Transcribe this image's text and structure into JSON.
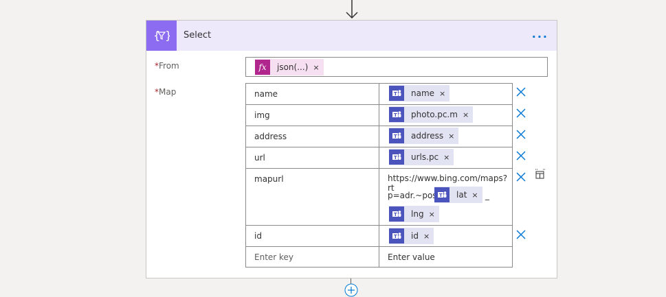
{
  "action": {
    "title": "Select",
    "more_label": "···"
  },
  "from": {
    "label": "From",
    "required_mark": "*",
    "token": {
      "label": "json(...)",
      "icon": "fx-icon",
      "close": "×"
    }
  },
  "map": {
    "label": "Map",
    "required_mark": "*",
    "rows": [
      {
        "key": "name",
        "tokens": [
          {
            "label": "name"
          }
        ]
      },
      {
        "key": "img",
        "tokens": [
          {
            "label": "photo.pc.m"
          }
        ]
      },
      {
        "key": "address",
        "tokens": [
          {
            "label": "address"
          }
        ]
      },
      {
        "key": "url",
        "tokens": [
          {
            "label": "urls.pc"
          }
        ]
      },
      {
        "key": "mapurl",
        "text_before": "https://www.bing.com/maps?rt",
        "text_line2": "p=adr.~pos.",
        "tokens": [
          {
            "label": "lat"
          },
          {
            "label": "lng"
          }
        ],
        "separator": "_"
      },
      {
        "key": "id",
        "tokens": [
          {
            "label": "id"
          }
        ]
      }
    ],
    "key_placeholder": "Enter key",
    "value_placeholder": "Enter value",
    "token_close": "×"
  },
  "colors": {
    "accent": "#0078d4",
    "header_bg": "#ede9fb",
    "action_icon_bg": "#8c6cf0",
    "teams_icon_bg": "#4b53bc",
    "fx_icon_bg": "#b0268c"
  }
}
